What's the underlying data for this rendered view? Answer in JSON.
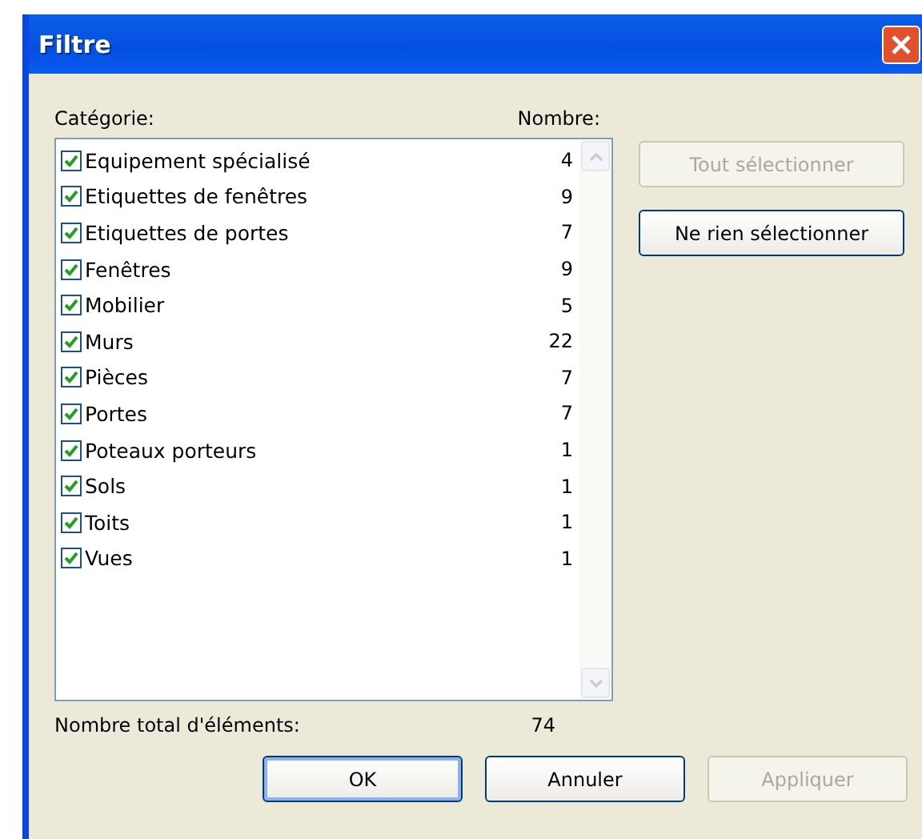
{
  "window": {
    "title": "Filtre"
  },
  "list": {
    "category_header": "Catégorie:",
    "count_header": "Nombre:",
    "items": [
      {
        "label": "Equipement spécialisé",
        "count": "4",
        "checked": true
      },
      {
        "label": "Etiquettes de fenêtres",
        "count": "9",
        "checked": true
      },
      {
        "label": "Etiquettes de portes",
        "count": "7",
        "checked": true
      },
      {
        "label": "Fenêtres",
        "count": "9",
        "checked": true
      },
      {
        "label": "Mobilier",
        "count": "5",
        "checked": true
      },
      {
        "label": "Murs",
        "count": "22",
        "checked": true
      },
      {
        "label": "Pièces",
        "count": "7",
        "checked": true
      },
      {
        "label": "Portes",
        "count": "7",
        "checked": true
      },
      {
        "label": "Poteaux porteurs",
        "count": "1",
        "checked": true
      },
      {
        "label": "Sols",
        "count": "1",
        "checked": true
      },
      {
        "label": "Toits",
        "count": "1",
        "checked": true
      },
      {
        "label": "Vues",
        "count": "1",
        "checked": true
      }
    ]
  },
  "side_buttons": [
    {
      "label": "Tout sélectionner",
      "disabled": true
    },
    {
      "label": "Ne rien sélectionner",
      "disabled": false
    }
  ],
  "total": {
    "label": "Nombre total d'éléments:",
    "value": "74"
  },
  "buttons": [
    {
      "label": "OK",
      "disabled": false,
      "default": true
    },
    {
      "label": "Annuler",
      "disabled": false,
      "default": false
    },
    {
      "label": "Appliquer",
      "disabled": true,
      "default": false
    }
  ]
}
